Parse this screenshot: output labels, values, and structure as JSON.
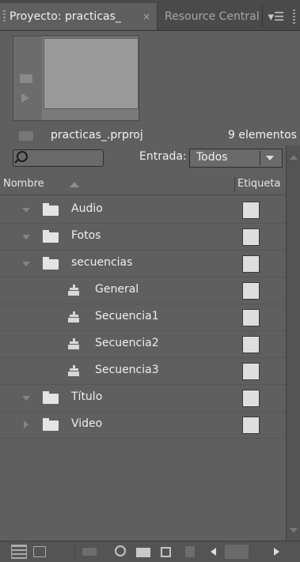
{
  "tabs": {
    "active_label": "Proyecto: practicas_",
    "close_glyph": "×",
    "inactive_label": "Resource Central",
    "menu_icon": "panel-menu-icon"
  },
  "project": {
    "file_name": "practicas_.prproj",
    "item_count": "9 elementos"
  },
  "filter": {
    "search_value": "",
    "entrada_label": "Entrada:",
    "entrada_value": "Todos"
  },
  "columns": {
    "name": "Nombre",
    "label": "Etiqueta"
  },
  "items": [
    {
      "name": "Audio",
      "type": "folder",
      "expanded": true
    },
    {
      "name": "Fotos",
      "type": "folder",
      "expanded": true
    },
    {
      "name": "secuencias",
      "type": "folder",
      "expanded": true
    },
    {
      "name": "General",
      "type": "sequence"
    },
    {
      "name": "Secuencia1",
      "type": "sequence"
    },
    {
      "name": "Secuencia2",
      "type": "sequence"
    },
    {
      "name": "Secuencia3",
      "type": "sequence"
    },
    {
      "name": "Título",
      "type": "folder",
      "expanded": true
    },
    {
      "name": "Video",
      "type": "folder",
      "expanded": false
    }
  ],
  "colors": {
    "panel_bg": "#5f5f5f",
    "label_chip": "#dedede"
  }
}
